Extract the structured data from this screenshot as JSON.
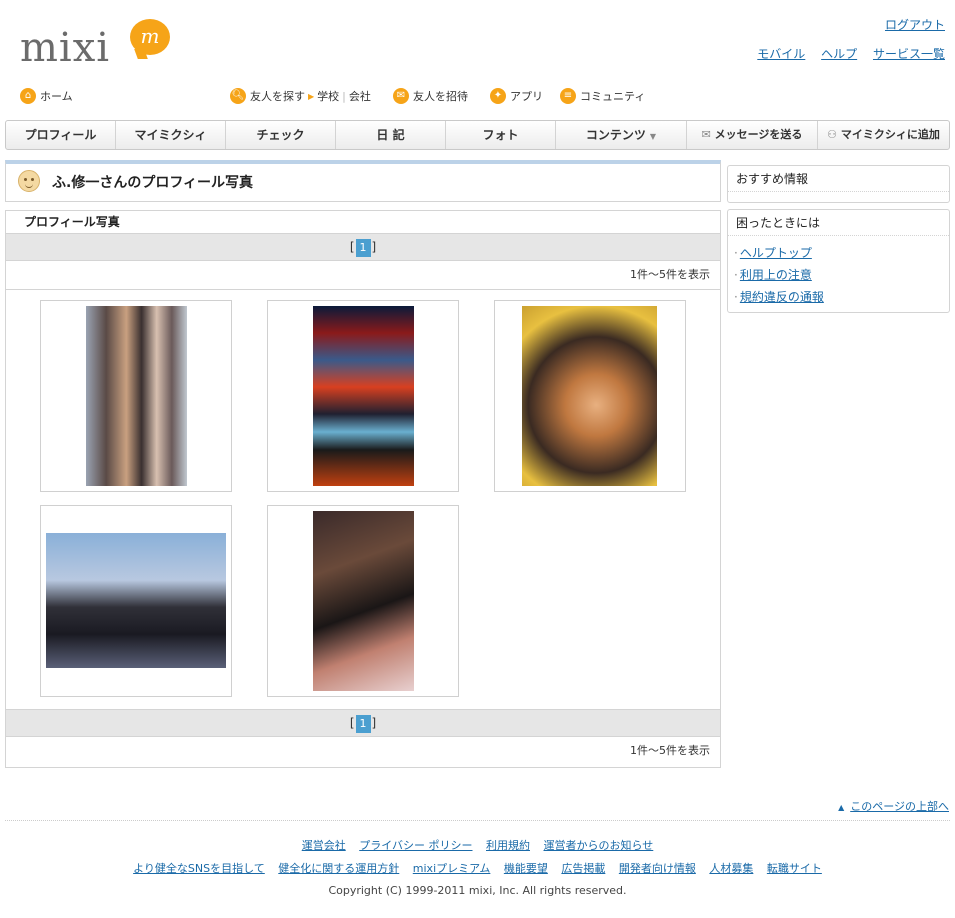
{
  "logo": {
    "text": "mixi",
    "badge": "m"
  },
  "top_links": {
    "logout": "ログアウト",
    "mobile": "モバイル",
    "help": "ヘルプ",
    "services": "サービス一覧"
  },
  "subnav": {
    "home": "ホーム",
    "find_friends": "友人を探す",
    "school": "学校",
    "company": "会社",
    "invite": "友人を招待",
    "apps": "アプリ",
    "community": "コミュニティ"
  },
  "mainnav": {
    "tabs": [
      "プロフィール",
      "マイミクシィ",
      "チェック",
      "日 記",
      "フォト",
      "コンテンツ"
    ],
    "send_message": "メッセージを送る",
    "add_mymixi": "マイミクシィに追加"
  },
  "page_title": "ふ.修一さんのプロフィール写真",
  "photos_section": {
    "header": "プロフィール写真",
    "pager_open": "[",
    "pager_page": "1",
    "pager_close": "]",
    "count_text": "1件～5件を表示",
    "photos": [
      "group-photo",
      "pachislot-photo",
      "portrait-photo",
      "group-indoor-photo",
      "gaming-photo"
    ]
  },
  "sidebar": {
    "recommend_title": "おすすめ情報",
    "trouble_title": "困ったときには",
    "links": [
      "ヘルプトップ",
      "利用上の注意",
      "規約違反の通報"
    ]
  },
  "footer": {
    "pagetop": "このページの上部へ",
    "row1": [
      "運営会社",
      "プライバシー ポリシー",
      "利用規約",
      "運営者からのお知らせ"
    ],
    "row2": [
      "より健全なSNSを目指して",
      "健全化に関する運用方針",
      "mixiプレミアム",
      "機能要望",
      "広告掲載",
      "開発者向け情報",
      "人材募集",
      "転職サイト"
    ],
    "copyright": "Copyright (C) 1999-2011 mixi, Inc. All rights reserved."
  }
}
